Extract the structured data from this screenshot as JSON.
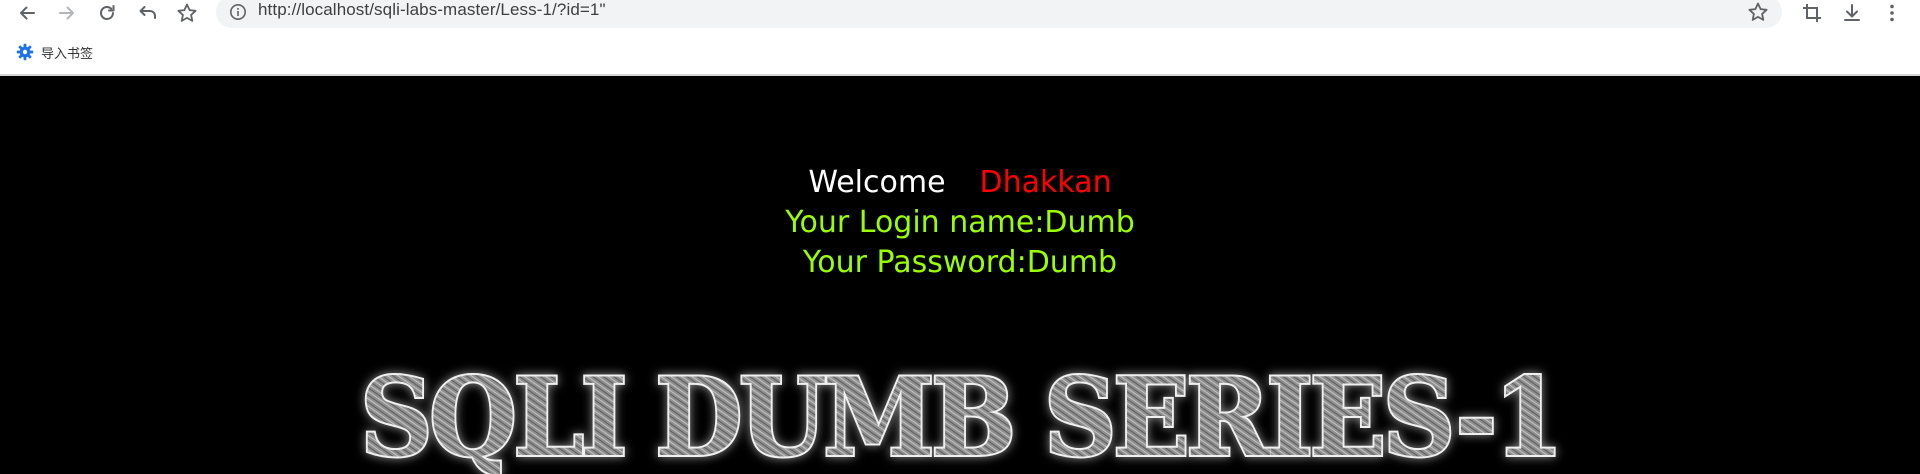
{
  "toolbar": {
    "back_icon": "arrow-left-icon",
    "forward_icon": "arrow-right-icon",
    "reload_icon": "reload-icon",
    "undo_icon": "undo-icon",
    "bookmark_icon": "star-outline-icon",
    "crop_icon": "crop-icon",
    "download_icon": "download-icon",
    "menu_icon": "kebab-menu-icon"
  },
  "omnibox": {
    "site_info_icon": "info-circle-icon",
    "url": "http://localhost/sqli-labs-master/Less-1/?id=1\""
  },
  "bookmarks_bar": {
    "import_label": "导入书签",
    "import_icon": "gear-icon"
  },
  "page": {
    "welcome": "Welcome",
    "welcome_name": "Dhakkan",
    "login_line": "Your Login name:Dumb",
    "password_line": "Your Password:Dumb",
    "banner": "SQLI DUMB SERIES-1",
    "colors": {
      "background": "#000000",
      "welcome": "#ffffff",
      "name": "#ff0000",
      "credentials": "#99ff00"
    }
  }
}
